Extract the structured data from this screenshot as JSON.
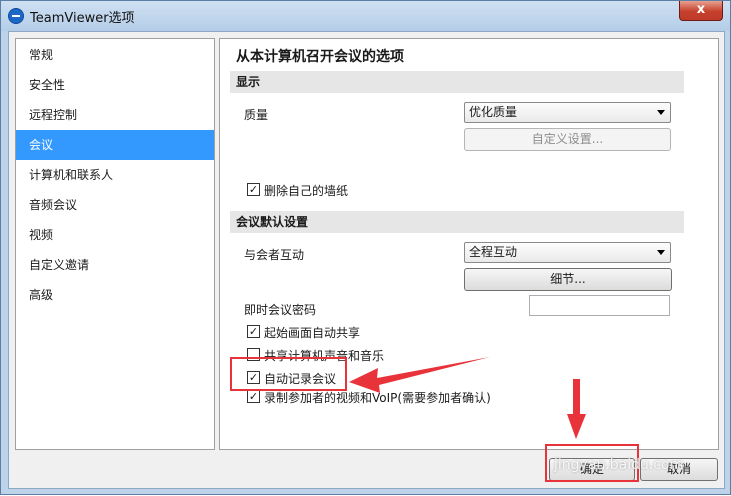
{
  "window": {
    "title": "TeamViewer选项",
    "close_glyph": "x"
  },
  "sidebar": {
    "items": [
      {
        "label": "常规",
        "selected": false
      },
      {
        "label": "安全性",
        "selected": false
      },
      {
        "label": "远程控制",
        "selected": false
      },
      {
        "label": "会议",
        "selected": true
      },
      {
        "label": "计算机和联系人",
        "selected": false
      },
      {
        "label": "音频会议",
        "selected": false
      },
      {
        "label": "视频",
        "selected": false
      },
      {
        "label": "自定义邀请",
        "selected": false
      },
      {
        "label": "高级",
        "selected": false
      }
    ]
  },
  "panel": {
    "title": "从本计算机召开会议的选项",
    "display_section": {
      "header": "显示",
      "quality_label": "质量",
      "quality_value": "优化质量",
      "custom_settings_button": "自定义设置...",
      "remove_wallpaper_label": "删除自己的墙纸",
      "remove_wallpaper_checked": true
    },
    "defaults_section": {
      "header": "会议默认设置",
      "interaction_label": "与会者互动",
      "interaction_value": "全程互动",
      "details_button": "细节...",
      "password_label": "即时会议密码",
      "password_value": "",
      "checkboxes": [
        {
          "label": "起始画面自动共享",
          "checked": true
        },
        {
          "label": "共享计算机声音和音乐",
          "checked": false
        },
        {
          "label": "自动记录会议",
          "checked": true
        },
        {
          "label": "录制参加者的视频和VoIP(需要参加者确认)",
          "checked": true
        }
      ]
    }
  },
  "footer": {
    "ok_button": "确定",
    "cancel_button": "取消"
  },
  "overlay": {
    "watermark": "jingyan.baidu.com",
    "annotation_color": "#e8333a"
  }
}
